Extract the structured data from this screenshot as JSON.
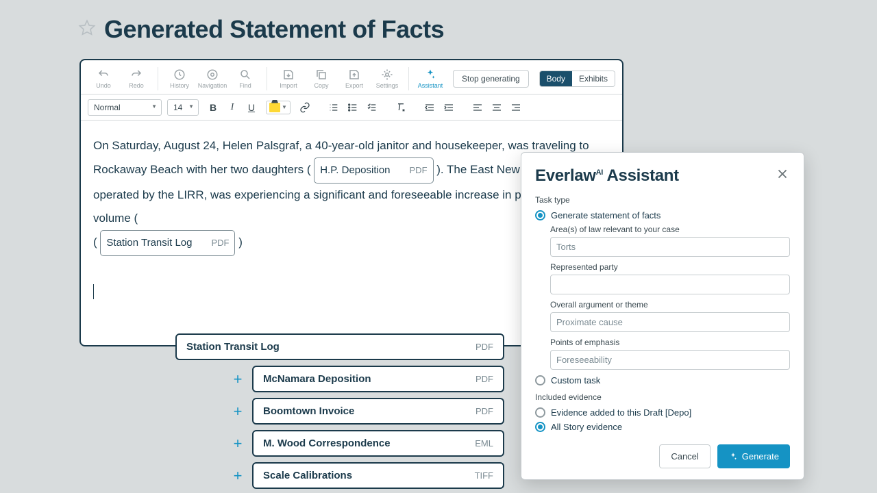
{
  "page": {
    "title": "Generated Statement of Facts"
  },
  "toolbar": {
    "undo": "Undo",
    "redo": "Redo",
    "history": "History",
    "navigation": "Navigation",
    "find": "Find",
    "import": "Import",
    "copy": "Copy",
    "export": "Export",
    "settings": "Settings",
    "assistant": "Assistant",
    "stop": "Stop generating",
    "body": "Body",
    "exhibits": "Exhibits"
  },
  "fmt": {
    "style": "Normal",
    "size": "14"
  },
  "doc": {
    "p1a": "On Saturday, August 24, Helen Palsgraf, a 40-year-old janitor and housekeeper, was traveling to Rockaway Beach with her two daughters ( ",
    "c1": {
      "name": "H.P. Deposition",
      "ext": "PDF"
    },
    "p1b": " ). The East New York station, operated by the LIRR, was experiencing a significant and foreseeable increase in passenger volume ( ",
    "c2": {
      "name": "Station Transit Log",
      "ext": "PDF"
    },
    "p1c": " )"
  },
  "evidence": [
    {
      "name": "Station Transit Log",
      "ext": "PDF",
      "offset": true,
      "add": false
    },
    {
      "name": "McNamara Deposition",
      "ext": "PDF",
      "offset": false,
      "add": true
    },
    {
      "name": "Boomtown Invoice",
      "ext": "PDF",
      "offset": false,
      "add": true
    },
    {
      "name": "M. Wood Correspondence",
      "ext": "EML",
      "offset": false,
      "add": true
    },
    {
      "name": "Scale Calibrations",
      "ext": "TIFF",
      "offset": false,
      "add": true
    }
  ],
  "panel": {
    "brand_pre": "Everlaw",
    "brand_sup": "AI",
    "brand_post": " Assistant",
    "task_type": "Task type",
    "opt_generate": "Generate statement of facts",
    "opt_custom": "Custom task",
    "areas_label": "Area(s) of law relevant to your case",
    "areas_val": "Torts",
    "party_label": "Represented party",
    "party_val": "",
    "arg_label": "Overall argument or theme",
    "arg_val": "Proximate cause",
    "points_label": "Points of emphasis",
    "points_val": "Foreseeability",
    "included": "Included evidence",
    "ev_draft": "Evidence added to this Draft [Depo]",
    "ev_all": "All Story evidence",
    "cancel": "Cancel",
    "generate": "Generate"
  }
}
